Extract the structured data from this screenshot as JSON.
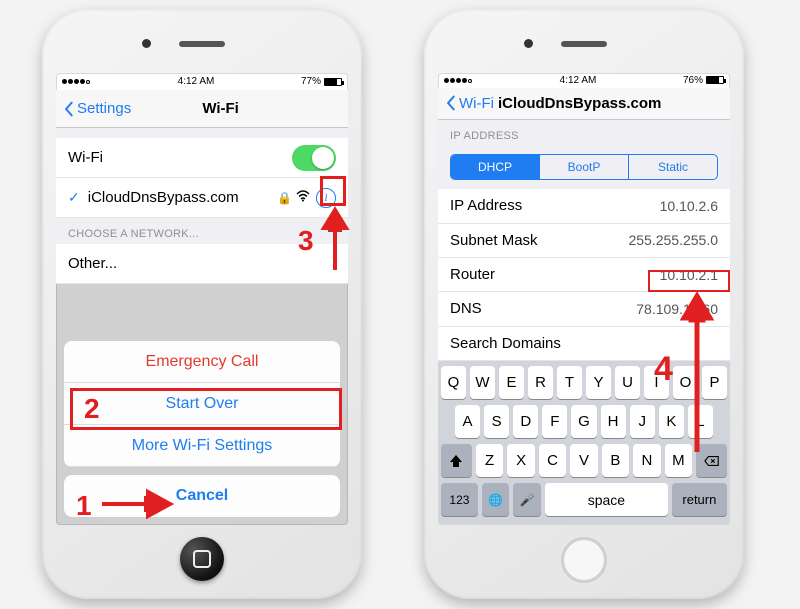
{
  "left": {
    "status": {
      "time": "4:12 AM",
      "battery": "77%"
    },
    "nav": {
      "back": "Settings",
      "title": "Wi-Fi"
    },
    "wifi_toggle_label": "Wi-Fi",
    "network": {
      "name": "iCloudDnsBypass.com"
    },
    "choose_label": "CHOOSE A NETWORK...",
    "other_label": "Other...",
    "sheet": {
      "emergency": "Emergency Call",
      "start_over": "Start Over",
      "more_wifi": "More Wi-Fi Settings",
      "cancel": "Cancel"
    }
  },
  "right": {
    "status": {
      "time": "4:12 AM",
      "battery": "76%"
    },
    "nav": {
      "back": "Wi-Fi",
      "title": "iCloudDnsBypass.com"
    },
    "ip_section": "IP ADDRESS",
    "tabs": {
      "dhcp": "DHCP",
      "bootp": "BootP",
      "static": "Static"
    },
    "rows": {
      "ip_label": "IP Address",
      "ip_value": "10.10.2.6",
      "mask_label": "Subnet Mask",
      "mask_value": "255.255.255.0",
      "router_label": "Router",
      "router_value": "10.10.2.1",
      "dns_label": "DNS",
      "dns_value": "78.109.17.60",
      "search_label": "Search Domains",
      "search_value": ""
    },
    "keyboard": {
      "r1": [
        "Q",
        "W",
        "E",
        "R",
        "T",
        "Y",
        "U",
        "I",
        "O",
        "P"
      ],
      "r2": [
        "A",
        "S",
        "D",
        "F",
        "G",
        "H",
        "J",
        "K",
        "L"
      ],
      "r3": [
        "Z",
        "X",
        "C",
        "V",
        "B",
        "N",
        "M"
      ],
      "num": "123",
      "space": "space",
      "return": "return"
    }
  },
  "annotations": {
    "n1": "1",
    "n2": "2",
    "n3": "3",
    "n4": "4"
  }
}
